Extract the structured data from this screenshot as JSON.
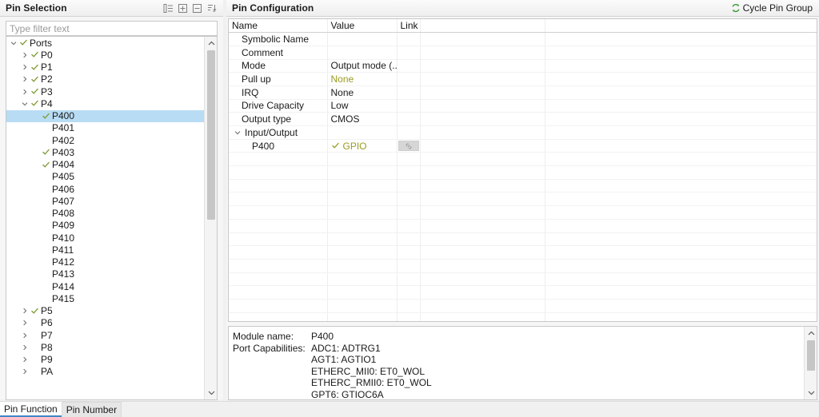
{
  "left_panel": {
    "title": "Pin Selection",
    "toolbar": [
      {
        "name": "collapse-all-icon",
        "tooltip": "Collapse All"
      },
      {
        "name": "expand-all-icon",
        "tooltip": "Expand All"
      },
      {
        "name": "collapse-icon",
        "tooltip": "Collapse"
      },
      {
        "name": "sort-alpha-icon",
        "tooltip": "Sort"
      }
    ],
    "filter": {
      "placeholder": "Type filter text",
      "value": ""
    },
    "tree": [
      {
        "label": "Ports",
        "indent": 0,
        "arrow": "down",
        "check": true,
        "selected": false
      },
      {
        "label": "P0",
        "indent": 1,
        "arrow": "right",
        "check": true,
        "selected": false
      },
      {
        "label": "P1",
        "indent": 1,
        "arrow": "right",
        "check": true,
        "selected": false
      },
      {
        "label": "P2",
        "indent": 1,
        "arrow": "right",
        "check": true,
        "selected": false
      },
      {
        "label": "P3",
        "indent": 1,
        "arrow": "right",
        "check": true,
        "selected": false
      },
      {
        "label": "P4",
        "indent": 1,
        "arrow": "down",
        "check": true,
        "selected": false
      },
      {
        "label": "P400",
        "indent": 2,
        "arrow": "none",
        "check": true,
        "selected": true
      },
      {
        "label": "P401",
        "indent": 2,
        "arrow": "none",
        "check": false,
        "selected": false
      },
      {
        "label": "P402",
        "indent": 2,
        "arrow": "none",
        "check": false,
        "selected": false
      },
      {
        "label": "P403",
        "indent": 2,
        "arrow": "none",
        "check": true,
        "selected": false
      },
      {
        "label": "P404",
        "indent": 2,
        "arrow": "none",
        "check": true,
        "selected": false
      },
      {
        "label": "P405",
        "indent": 2,
        "arrow": "none",
        "check": false,
        "selected": false
      },
      {
        "label": "P406",
        "indent": 2,
        "arrow": "none",
        "check": false,
        "selected": false
      },
      {
        "label": "P407",
        "indent": 2,
        "arrow": "none",
        "check": false,
        "selected": false
      },
      {
        "label": "P408",
        "indent": 2,
        "arrow": "none",
        "check": false,
        "selected": false
      },
      {
        "label": "P409",
        "indent": 2,
        "arrow": "none",
        "check": false,
        "selected": false
      },
      {
        "label": "P410",
        "indent": 2,
        "arrow": "none",
        "check": false,
        "selected": false
      },
      {
        "label": "P411",
        "indent": 2,
        "arrow": "none",
        "check": false,
        "selected": false
      },
      {
        "label": "P412",
        "indent": 2,
        "arrow": "none",
        "check": false,
        "selected": false
      },
      {
        "label": "P413",
        "indent": 2,
        "arrow": "none",
        "check": false,
        "selected": false
      },
      {
        "label": "P414",
        "indent": 2,
        "arrow": "none",
        "check": false,
        "selected": false
      },
      {
        "label": "P415",
        "indent": 2,
        "arrow": "none",
        "check": false,
        "selected": false
      },
      {
        "label": "P5",
        "indent": 1,
        "arrow": "right",
        "check": true,
        "selected": false
      },
      {
        "label": "P6",
        "indent": 1,
        "arrow": "right",
        "check": false,
        "selected": false
      },
      {
        "label": "P7",
        "indent": 1,
        "arrow": "right",
        "check": false,
        "selected": false
      },
      {
        "label": "P8",
        "indent": 1,
        "arrow": "right",
        "check": false,
        "selected": false
      },
      {
        "label": "P9",
        "indent": 1,
        "arrow": "right",
        "check": false,
        "selected": false
      },
      {
        "label": "PA",
        "indent": 1,
        "arrow": "right",
        "check": false,
        "selected": false
      }
    ]
  },
  "right_panel": {
    "title": "Pin Configuration",
    "cycle_pin_group": {
      "label": "Cycle Pin Group",
      "icon": "cycle-icon"
    },
    "table": {
      "columns": [
        "Name",
        "Value",
        "Link",
        "",
        ""
      ],
      "rows": [
        {
          "name": "Symbolic Name",
          "indent": 1,
          "value": "",
          "value_style": "plain",
          "arrow": "none",
          "check": false,
          "link": false
        },
        {
          "name": "Comment",
          "indent": 1,
          "value": "",
          "value_style": "plain",
          "arrow": "none",
          "check": false,
          "link": false
        },
        {
          "name": "Mode",
          "indent": 1,
          "value": "Output mode (...",
          "value_style": "plain",
          "arrow": "none",
          "check": false,
          "link": false
        },
        {
          "name": "Pull up",
          "indent": 1,
          "value": "None",
          "value_style": "olive",
          "arrow": "none",
          "check": false,
          "link": false
        },
        {
          "name": "IRQ",
          "indent": 1,
          "value": "None",
          "value_style": "plain",
          "arrow": "none",
          "check": false,
          "link": false
        },
        {
          "name": "Drive Capacity",
          "indent": 1,
          "value": "Low",
          "value_style": "plain",
          "arrow": "none",
          "check": false,
          "link": false
        },
        {
          "name": "Output type",
          "indent": 1,
          "value": "CMOS",
          "value_style": "plain",
          "arrow": "none",
          "check": false,
          "link": false
        },
        {
          "name": "Input/Output",
          "indent": 0,
          "value": "",
          "value_style": "plain",
          "arrow": "down",
          "check": false,
          "link": false
        },
        {
          "name": "P400",
          "indent": 2,
          "value": "GPIO",
          "value_style": "olive",
          "arrow": "none",
          "check": true,
          "link": true
        }
      ],
      "empty_row_count": 13
    },
    "detail": {
      "module_name_label": "Module name:",
      "module_name_value": "P400",
      "capabilities_label": "Port Capabilities:",
      "capabilities": [
        "ADC1: ADTRG1",
        "AGT1: AGTIO1",
        "ETHERC_MII0: ET0_WOL",
        "ETHERC_RMII0: ET0_WOL",
        "GPT6: GTIOC6A"
      ]
    }
  },
  "bottom_tabs": [
    {
      "label": "Pin Function",
      "active": true
    },
    {
      "label": "Pin Number",
      "active": false
    }
  ],
  "colors": {
    "selection": "#b8dcf4",
    "olive": "#9a9c22",
    "check_green": "#7d9a2e",
    "tab_accent": "#3f87c4",
    "panel_bg": "#f6f6f6"
  }
}
